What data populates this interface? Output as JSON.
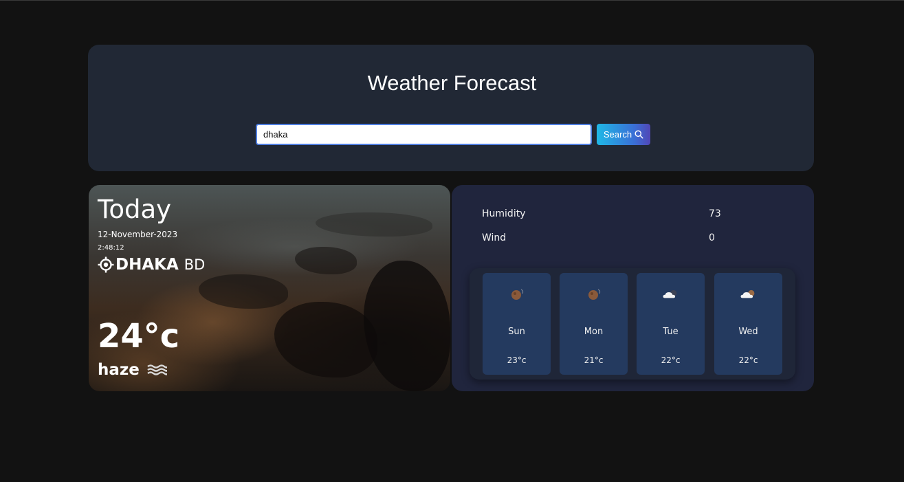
{
  "header": {
    "title": "Weather Forecast",
    "search": {
      "value": "dhaka",
      "button_label": "Search",
      "button_icon": "search-icon"
    }
  },
  "today": {
    "title": "Today",
    "date": "12-November-2023",
    "time": "2:48:12",
    "location_icon": "location-crosshair-icon",
    "city": "DHAKA",
    "country": "BD",
    "temperature": "24°c",
    "condition": "haze",
    "condition_icon": "haze-icon"
  },
  "details": {
    "humidity_label": "Humidity",
    "humidity_value": "73",
    "wind_label": "Wind",
    "wind_value": "0"
  },
  "forecast": [
    {
      "day": "Sun",
      "temp": "23°c",
      "icon": "dark-moon-icon"
    },
    {
      "day": "Mon",
      "temp": "21°c",
      "icon": "dark-moon-icon"
    },
    {
      "day": "Tue",
      "temp": "22°c",
      "icon": "cloud-moon-icon"
    },
    {
      "day": "Wed",
      "temp": "22°c",
      "icon": "cloud-moon-icon"
    }
  ],
  "colors": {
    "page_background": "#121212",
    "header_card": "#212835",
    "details_card": "#20253d",
    "forecast_day_card": "#243a5f",
    "search_border": "#4f7ee0"
  }
}
